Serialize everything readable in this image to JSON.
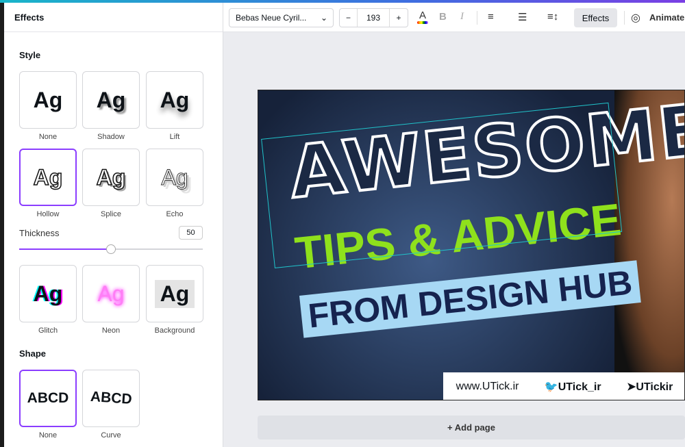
{
  "panel": {
    "title": "Effects",
    "style_heading": "Style",
    "thickness_label": "Thickness",
    "thickness_value": "50",
    "thickness_fraction": 0.5,
    "shape_heading": "Shape",
    "styles": [
      {
        "label": "None",
        "sample": "Ag"
      },
      {
        "label": "Shadow",
        "sample": "Ag"
      },
      {
        "label": "Lift",
        "sample": "Ag"
      },
      {
        "label": "Hollow",
        "sample": "Ag"
      },
      {
        "label": "Splice",
        "sample": "Ag"
      },
      {
        "label": "Echo",
        "sample": "Ag"
      },
      {
        "label": "Glitch",
        "sample": "Ag"
      },
      {
        "label": "Neon",
        "sample": "Ag"
      },
      {
        "label": "Background",
        "sample": "Ag"
      }
    ],
    "shapes": [
      {
        "label": "None",
        "sample": "ABCD"
      },
      {
        "label": "Curve",
        "sample": "ABCD"
      }
    ]
  },
  "toolbar": {
    "font": "Bebas Neue Cyril...",
    "minus": "−",
    "size": "193",
    "plus": "+",
    "color_glyph": "A",
    "bold": "B",
    "italic": "I",
    "effects": "Effects",
    "animate": "Animate"
  },
  "design": {
    "line1": "AWESOME",
    "line2": "TIPS & ADVICE",
    "line3": "FROM DESIGN HUB",
    "website": "www.UTick.ir",
    "twitter": "UTick_ir",
    "telegram": "UTickir"
  },
  "add_page": "+ Add page",
  "colors": {
    "accent": "#8b3dff",
    "selection": "#20c4cb",
    "green": "#8fe11c"
  }
}
